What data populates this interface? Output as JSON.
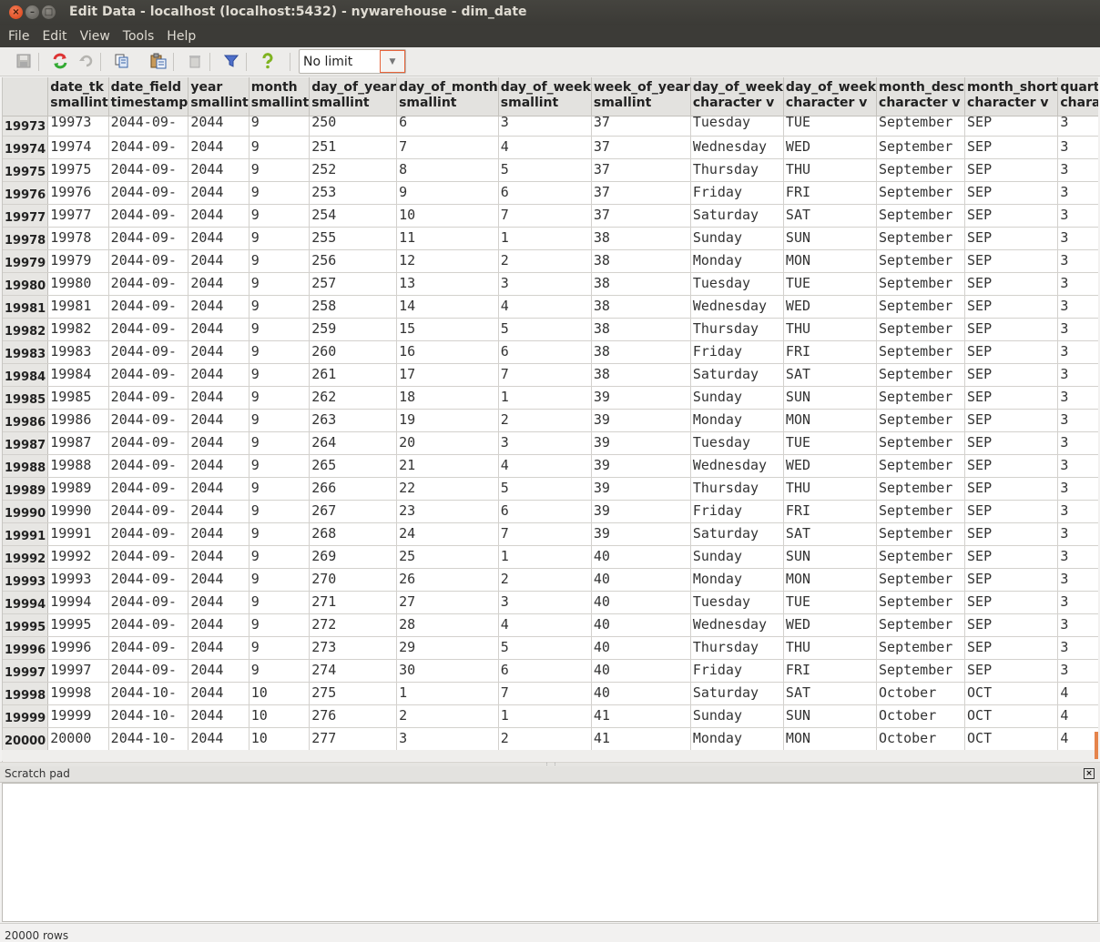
{
  "window": {
    "title": "Edit Data - localhost (localhost:5432) - nywarehouse - dim_date"
  },
  "menu": [
    "File",
    "Edit",
    "View",
    "Tools",
    "Help"
  ],
  "toolbar": {
    "icons": [
      "save-icon",
      "refresh-icon",
      "undo-icon",
      "copy-icon",
      "paste-icon",
      "delete-icon",
      "filter-icon",
      "help-icon"
    ],
    "limit_value": "No limit"
  },
  "columns": [
    {
      "name": "date_tk",
      "type": "smallint"
    },
    {
      "name": "date_field",
      "type": "timestamp"
    },
    {
      "name": "year",
      "type": "smallint"
    },
    {
      "name": "month",
      "type": "smallint"
    },
    {
      "name": "day_of_year",
      "type": "smallint"
    },
    {
      "name": "day_of_month",
      "type": "smallint"
    },
    {
      "name": "day_of_week",
      "type": "smallint"
    },
    {
      "name": "week_of_year",
      "type": "smallint"
    },
    {
      "name": "day_of_week",
      "type": "character v"
    },
    {
      "name": "day_of_week",
      "type": "character v"
    },
    {
      "name": "month_desc",
      "type": "character v"
    },
    {
      "name": "month_short",
      "type": "character v"
    },
    {
      "name": "quarter",
      "type": "character v"
    }
  ],
  "rows": [
    {
      "id": "19973",
      "cells": [
        "19973",
        "2044-09-",
        "2044",
        "9",
        "250",
        "6",
        "3",
        "37",
        "Tuesday",
        "TUE",
        "September",
        "SEP",
        "3"
      ]
    },
    {
      "id": "19974",
      "cells": [
        "19974",
        "2044-09-",
        "2044",
        "9",
        "251",
        "7",
        "4",
        "37",
        "Wednesday",
        "WED",
        "September",
        "SEP",
        "3"
      ]
    },
    {
      "id": "19975",
      "cells": [
        "19975",
        "2044-09-",
        "2044",
        "9",
        "252",
        "8",
        "5",
        "37",
        "Thursday",
        "THU",
        "September",
        "SEP",
        "3"
      ]
    },
    {
      "id": "19976",
      "cells": [
        "19976",
        "2044-09-",
        "2044",
        "9",
        "253",
        "9",
        "6",
        "37",
        "Friday",
        "FRI",
        "September",
        "SEP",
        "3"
      ]
    },
    {
      "id": "19977",
      "cells": [
        "19977",
        "2044-09-",
        "2044",
        "9",
        "254",
        "10",
        "7",
        "37",
        "Saturday",
        "SAT",
        "September",
        "SEP",
        "3"
      ]
    },
    {
      "id": "19978",
      "cells": [
        "19978",
        "2044-09-",
        "2044",
        "9",
        "255",
        "11",
        "1",
        "38",
        "Sunday",
        "SUN",
        "September",
        "SEP",
        "3"
      ]
    },
    {
      "id": "19979",
      "cells": [
        "19979",
        "2044-09-",
        "2044",
        "9",
        "256",
        "12",
        "2",
        "38",
        "Monday",
        "MON",
        "September",
        "SEP",
        "3"
      ]
    },
    {
      "id": "19980",
      "cells": [
        "19980",
        "2044-09-",
        "2044",
        "9",
        "257",
        "13",
        "3",
        "38",
        "Tuesday",
        "TUE",
        "September",
        "SEP",
        "3"
      ]
    },
    {
      "id": "19981",
      "cells": [
        "19981",
        "2044-09-",
        "2044",
        "9",
        "258",
        "14",
        "4",
        "38",
        "Wednesday",
        "WED",
        "September",
        "SEP",
        "3"
      ]
    },
    {
      "id": "19982",
      "cells": [
        "19982",
        "2044-09-",
        "2044",
        "9",
        "259",
        "15",
        "5",
        "38",
        "Thursday",
        "THU",
        "September",
        "SEP",
        "3"
      ]
    },
    {
      "id": "19983",
      "cells": [
        "19983",
        "2044-09-",
        "2044",
        "9",
        "260",
        "16",
        "6",
        "38",
        "Friday",
        "FRI",
        "September",
        "SEP",
        "3"
      ]
    },
    {
      "id": "19984",
      "cells": [
        "19984",
        "2044-09-",
        "2044",
        "9",
        "261",
        "17",
        "7",
        "38",
        "Saturday",
        "SAT",
        "September",
        "SEP",
        "3"
      ]
    },
    {
      "id": "19985",
      "cells": [
        "19985",
        "2044-09-",
        "2044",
        "9",
        "262",
        "18",
        "1",
        "39",
        "Sunday",
        "SUN",
        "September",
        "SEP",
        "3"
      ]
    },
    {
      "id": "19986",
      "cells": [
        "19986",
        "2044-09-",
        "2044",
        "9",
        "263",
        "19",
        "2",
        "39",
        "Monday",
        "MON",
        "September",
        "SEP",
        "3"
      ]
    },
    {
      "id": "19987",
      "cells": [
        "19987",
        "2044-09-",
        "2044",
        "9",
        "264",
        "20",
        "3",
        "39",
        "Tuesday",
        "TUE",
        "September",
        "SEP",
        "3"
      ]
    },
    {
      "id": "19988",
      "cells": [
        "19988",
        "2044-09-",
        "2044",
        "9",
        "265",
        "21",
        "4",
        "39",
        "Wednesday",
        "WED",
        "September",
        "SEP",
        "3"
      ]
    },
    {
      "id": "19989",
      "cells": [
        "19989",
        "2044-09-",
        "2044",
        "9",
        "266",
        "22",
        "5",
        "39",
        "Thursday",
        "THU",
        "September",
        "SEP",
        "3"
      ]
    },
    {
      "id": "19990",
      "cells": [
        "19990",
        "2044-09-",
        "2044",
        "9",
        "267",
        "23",
        "6",
        "39",
        "Friday",
        "FRI",
        "September",
        "SEP",
        "3"
      ]
    },
    {
      "id": "19991",
      "cells": [
        "19991",
        "2044-09-",
        "2044",
        "9",
        "268",
        "24",
        "7",
        "39",
        "Saturday",
        "SAT",
        "September",
        "SEP",
        "3"
      ]
    },
    {
      "id": "19992",
      "cells": [
        "19992",
        "2044-09-",
        "2044",
        "9",
        "269",
        "25",
        "1",
        "40",
        "Sunday",
        "SUN",
        "September",
        "SEP",
        "3"
      ]
    },
    {
      "id": "19993",
      "cells": [
        "19993",
        "2044-09-",
        "2044",
        "9",
        "270",
        "26",
        "2",
        "40",
        "Monday",
        "MON",
        "September",
        "SEP",
        "3"
      ]
    },
    {
      "id": "19994",
      "cells": [
        "19994",
        "2044-09-",
        "2044",
        "9",
        "271",
        "27",
        "3",
        "40",
        "Tuesday",
        "TUE",
        "September",
        "SEP",
        "3"
      ]
    },
    {
      "id": "19995",
      "cells": [
        "19995",
        "2044-09-",
        "2044",
        "9",
        "272",
        "28",
        "4",
        "40",
        "Wednesday",
        "WED",
        "September",
        "SEP",
        "3"
      ]
    },
    {
      "id": "19996",
      "cells": [
        "19996",
        "2044-09-",
        "2044",
        "9",
        "273",
        "29",
        "5",
        "40",
        "Thursday",
        "THU",
        "September",
        "SEP",
        "3"
      ]
    },
    {
      "id": "19997",
      "cells": [
        "19997",
        "2044-09-",
        "2044",
        "9",
        "274",
        "30",
        "6",
        "40",
        "Friday",
        "FRI",
        "September",
        "SEP",
        "3"
      ]
    },
    {
      "id": "19998",
      "cells": [
        "19998",
        "2044-10-",
        "2044",
        "10",
        "275",
        "1",
        "7",
        "40",
        "Saturday",
        "SAT",
        "October",
        "OCT",
        "4"
      ]
    },
    {
      "id": "19999",
      "cells": [
        "19999",
        "2044-10-",
        "2044",
        "10",
        "276",
        "2",
        "1",
        "41",
        "Sunday",
        "SUN",
        "October",
        "OCT",
        "4"
      ]
    },
    {
      "id": "20000",
      "cells": [
        "20000",
        "2044-10-",
        "2044",
        "10",
        "277",
        "3",
        "2",
        "41",
        "Monday",
        "MON",
        "October",
        "OCT",
        "4"
      ]
    }
  ],
  "scratch_pad": {
    "label": "Scratch pad"
  },
  "status": {
    "text": "20000 rows"
  }
}
